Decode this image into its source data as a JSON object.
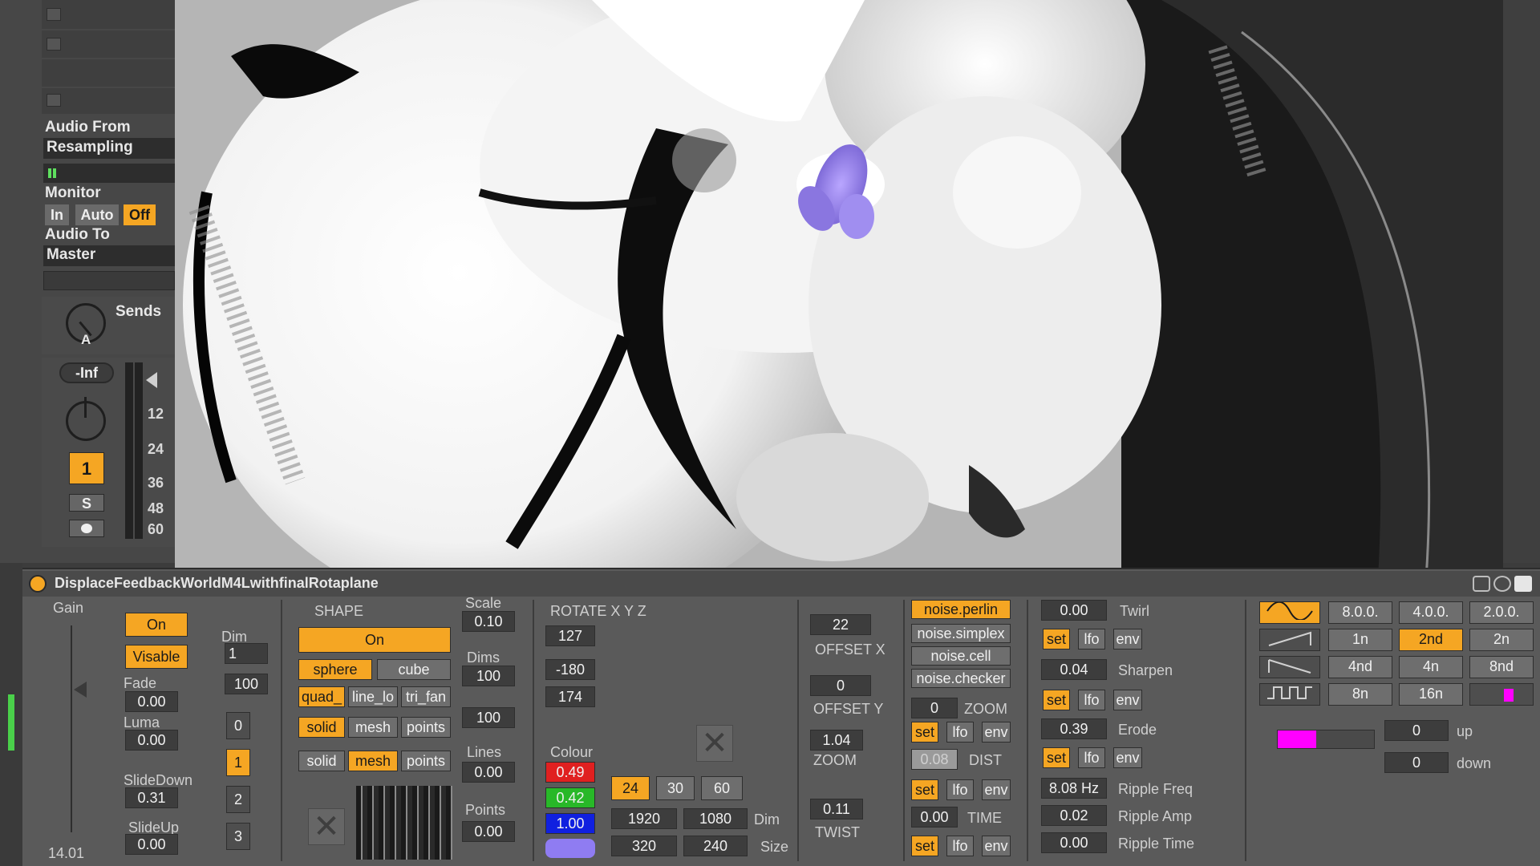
{
  "mixer": {
    "audio_from_label": "Audio From",
    "audio_from_value": "Resampling",
    "monitor_label": "Monitor",
    "monitor_in": "In",
    "monitor_auto": "Auto",
    "monitor_off": "Off",
    "audio_to_label": "Audio To",
    "audio_to_value": "Master",
    "sends_label": "Sends",
    "send_a": "A",
    "volume": "-Inf",
    "track_number": "1",
    "solo": "S",
    "meter_ticks": [
      "12",
      "24",
      "36",
      "48",
      "60"
    ]
  },
  "device": {
    "title": "DisplaceFeedbackWorldM4LwithfinalRotaplane",
    "gain_label": "Gain",
    "gain_value": "14.01",
    "on_button": "On",
    "visable_button": "Visable",
    "fade_label": "Fade",
    "fade_value": "0.00",
    "luma_label": "Luma",
    "luma_value": "0.00",
    "slidedown_label": "SlideDown",
    "slidedown_value": "0.31",
    "slideup_label": "SlideUp",
    "slideup_value": "0.00",
    "dim_label": "Dim",
    "dim_value": "1",
    "dim_100": "100",
    "index_buttons": [
      "0",
      "1",
      "2",
      "3"
    ],
    "shape_label": "SHAPE",
    "shape_on": "On",
    "scale_label": "Scale",
    "scale_value": "0.10",
    "dims_label": "Dims",
    "dims_value": "100",
    "dims_value2": "100",
    "shape_sphere": "sphere",
    "shape_cube": "cube",
    "prim_quad": "quad_",
    "prim_line": "line_lo",
    "prim_trifan": "tri_fan",
    "draw1_solid": "solid",
    "draw1_mesh": "mesh",
    "draw1_points": "points",
    "draw2_solid": "solid",
    "draw2_mesh": "mesh",
    "draw2_points": "points",
    "lines_label": "Lines",
    "lines_value": "0.00",
    "points_label": "Points",
    "points_value": "0.00",
    "rotate_label": "ROTATE X Y Z",
    "rotate_x": "127",
    "rotate_y": "-180",
    "rotate_z": "174",
    "colour_label": "Colour",
    "colour_r": "0.49",
    "colour_g": "0.42",
    "colour_b": "1.00",
    "colour_swatch": "#8f7cf2",
    "fps_24": "24",
    "fps_30": "30",
    "fps_60": "60",
    "dim_w": "1920",
    "dim_h": "1080",
    "dim_label2": "Dim",
    "size_w": "320",
    "size_h": "240",
    "size_label": "Size",
    "offset_x_value": "22",
    "offset_x_label": "OFFSET X",
    "offset_y_value": "0",
    "offset_y_label": "OFFSET Y",
    "zoom_value": "1.04",
    "zoom_label": "ZOOM",
    "twist_value": "0.11",
    "twist_label": "TWIST",
    "noise_perlin": "noise.perlin",
    "noise_simplex": "noise.simplex",
    "noise_cell": "noise.cell",
    "noise_checker": "noise.checker",
    "nzoom_value": "0",
    "nzoom_label": "ZOOM",
    "dist_value": "0.08",
    "dist_label": "DIST",
    "time_value": "0.00",
    "time_label": "TIME",
    "set": "set",
    "lfo": "lfo",
    "env": "env",
    "twirl_value": "0.00",
    "twirl_label": "Twirl",
    "sharpen_value": "0.04",
    "sharpen_label": "Sharpen",
    "erode_value": "0.39",
    "erode_label": "Erode",
    "ripple_freq_value": "8.08 Hz",
    "ripple_freq_label": "Ripple Freq",
    "ripple_amp_value": "0.02",
    "ripple_amp_label": "Ripple Amp",
    "ripple_time_value": "0.00",
    "ripple_time_label": "Ripple Time",
    "rate_row1": [
      "8.0.0.",
      "4.0.0.",
      "2.0.0."
    ],
    "rate_row2": [
      "1n",
      "2nd",
      "2n"
    ],
    "rate_row3": [
      "4nd",
      "4n",
      "8nd"
    ],
    "rate_row4": [
      "8n",
      "16n"
    ],
    "up_value": "0",
    "up_label": "up",
    "down_value": "0",
    "down_label": "down",
    "accent": "#f5a623",
    "magenta": "#ff00ff"
  }
}
